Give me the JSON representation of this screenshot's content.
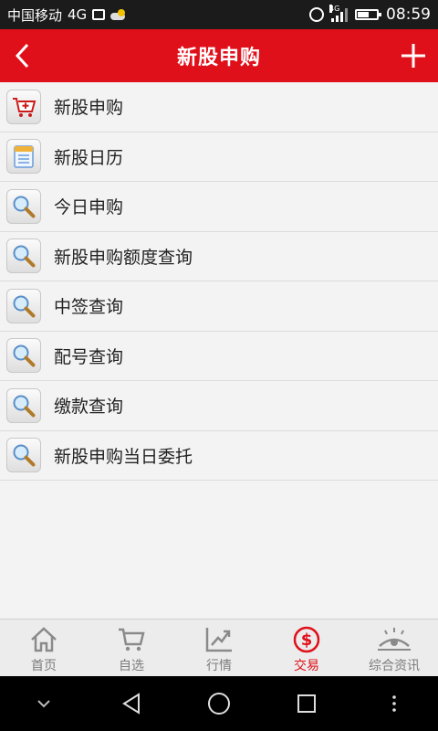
{
  "status_bar": {
    "carrier": "中国移动",
    "network": "4G",
    "signal_network": "4G",
    "time": "08:59",
    "battery_level": 0.55
  },
  "header": {
    "title": "新股申购",
    "back_icon": "chevron-left-icon",
    "add_icon": "plus-icon"
  },
  "menu": {
    "items": [
      {
        "label": "新股申购",
        "icon": "cart-icon"
      },
      {
        "label": "新股日历",
        "icon": "calendar-icon"
      },
      {
        "label": "今日申购",
        "icon": "magnifier-icon"
      },
      {
        "label": "新股申购额度查询",
        "icon": "magnifier-icon"
      },
      {
        "label": "中签查询",
        "icon": "magnifier-icon"
      },
      {
        "label": "配号查询",
        "icon": "magnifier-icon"
      },
      {
        "label": "缴款查询",
        "icon": "magnifier-icon"
      },
      {
        "label": "新股申购当日委托",
        "icon": "magnifier-icon"
      }
    ]
  },
  "tabs": [
    {
      "label": "首页",
      "icon": "home-icon",
      "active": false
    },
    {
      "label": "自选",
      "icon": "cart-icon",
      "active": false
    },
    {
      "label": "行情",
      "icon": "chart-icon",
      "active": false
    },
    {
      "label": "交易",
      "icon": "dollar-icon",
      "active": true
    },
    {
      "label": "综合资讯",
      "icon": "eye-icon",
      "active": false
    }
  ],
  "colors": {
    "accent": "#e0101a",
    "inactive_tab": "#7c7c7c"
  }
}
